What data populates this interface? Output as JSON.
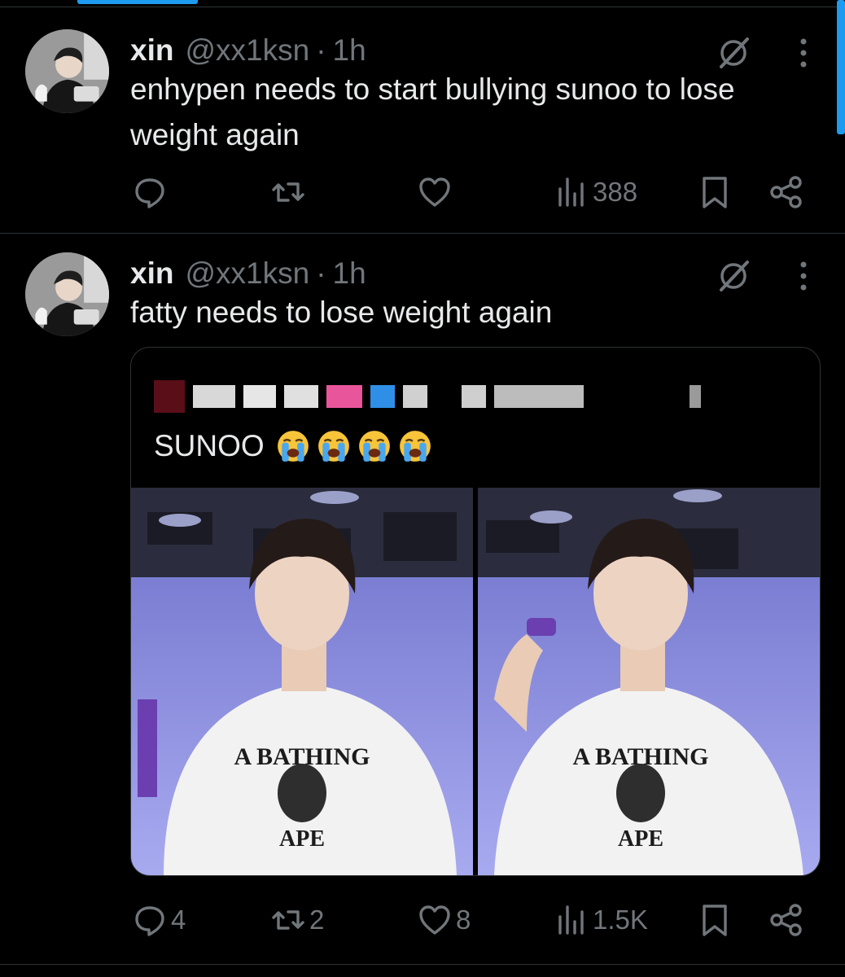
{
  "tweets": [
    {
      "name": "xin",
      "handle": "@xx1ksn",
      "separator": "·",
      "time": "1h",
      "text": "enhypen needs to start bullying sunoo to lose weight again",
      "views": "388"
    },
    {
      "name": "xin",
      "handle": "@xx1ksn",
      "separator": "·",
      "time": "1h",
      "text": "fatty needs to lose weight again",
      "replies": "4",
      "reposts": "2",
      "likes": "8",
      "views": "1.5K",
      "quote": {
        "text": "SUNOO",
        "emoji": "loudly-crying-face",
        "emoji_count": 4,
        "images": [
          {
            "subject": "performer in white A BATHING APE t-shirt holding microphone",
            "shirt_text_top": "A BATHING",
            "shirt_text_bottom": "APE"
          },
          {
            "subject": "performer in white A BATHING APE t-shirt holding microphone to ear",
            "shirt_text_top": "A BATHING",
            "shirt_text_bottom": "APE"
          }
        ]
      }
    }
  ],
  "colors": {
    "background": "#000000",
    "text": "#e7e9ea",
    "secondary": "#71767b",
    "divider": "#2f3336",
    "accent": "#1d9bf0",
    "sky": "#8c8fe0"
  }
}
